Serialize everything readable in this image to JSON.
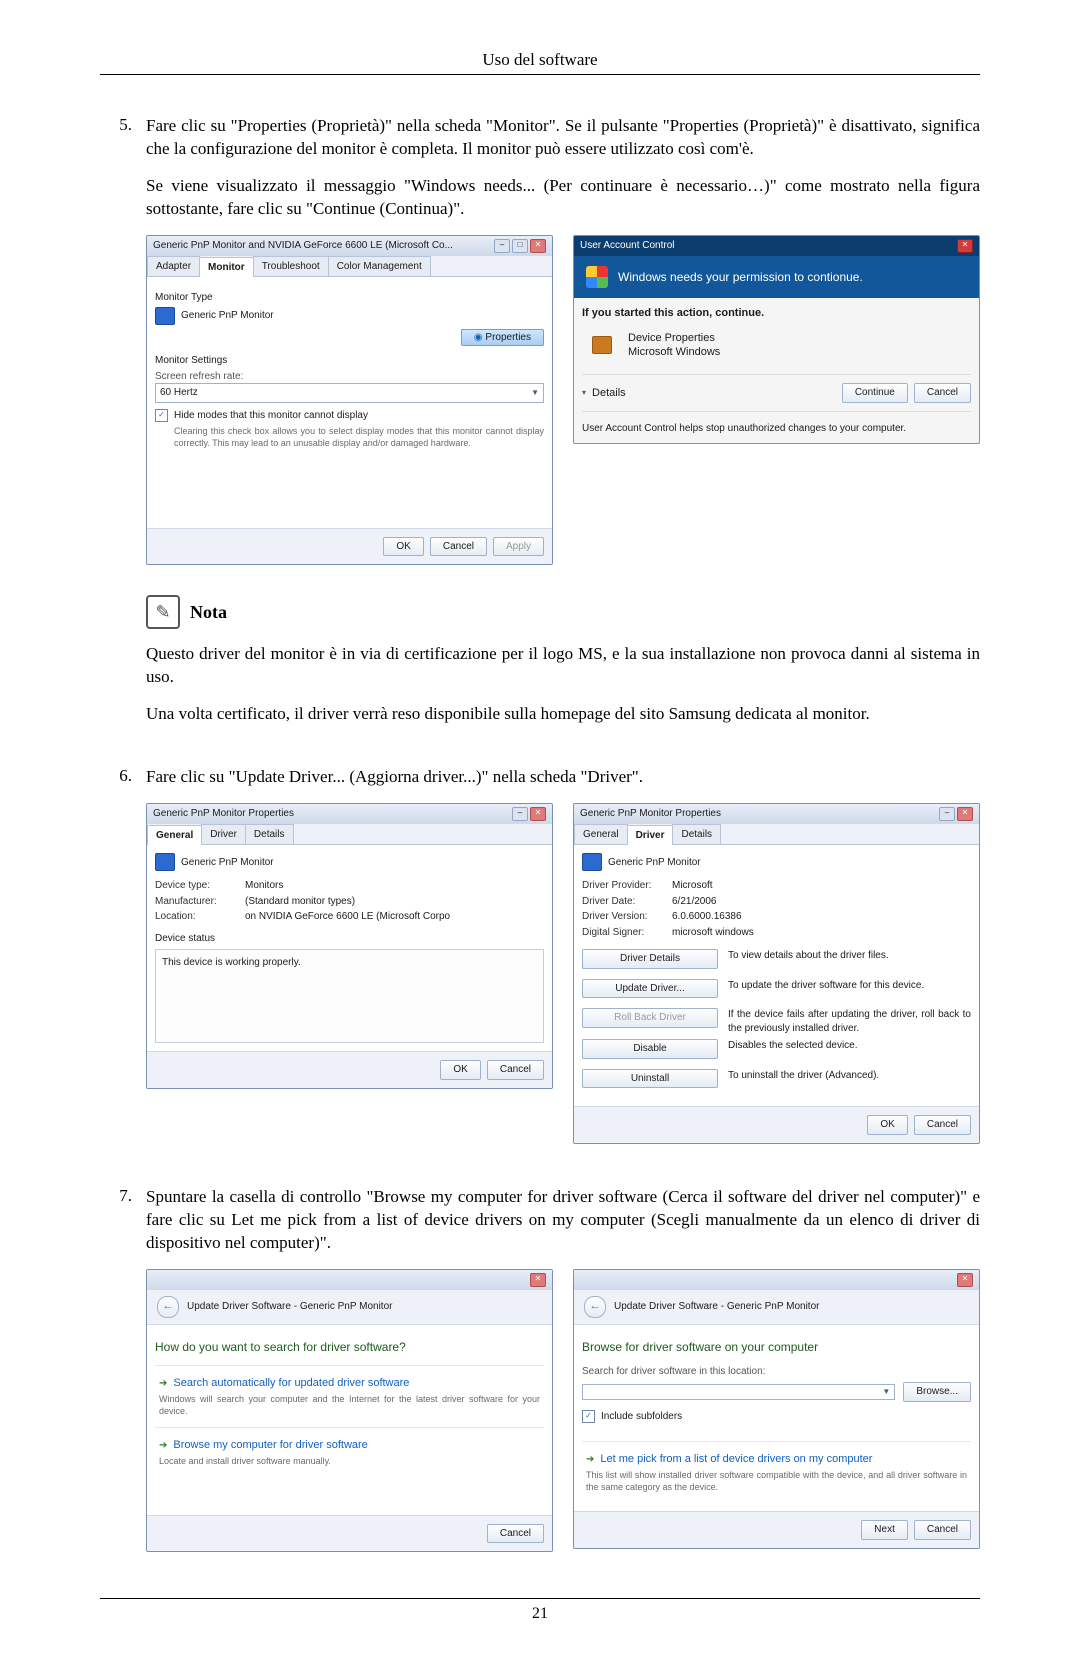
{
  "header": {
    "running_head": "Uso del software"
  },
  "footer": {
    "page_number": "21"
  },
  "steps": {
    "s5": {
      "num": "5.",
      "p1": "Fare clic su \"Properties (Proprietà)\" nella scheda \"Monitor\". Se il pulsante \"Properties (Proprietà)\" è disattivato, significa che la configurazione del monitor è completa. Il monitor può essere utilizzato così com'è.",
      "p2": "Se viene visualizzato il messaggio \"Windows needs... (Per continuare è necessario…)\" come mostrato nella figura sottostante, fare clic su \"Continue (Continua)\"."
    },
    "s6": {
      "num": "6.",
      "p1": "Fare clic su \"Update Driver... (Aggiorna driver...)\" nella scheda \"Driver\"."
    },
    "s7": {
      "num": "7.",
      "p1": "Spuntare la casella di controllo \"Browse my computer for driver software (Cerca il software del driver nel computer)\" e fare clic su Let me pick from a list of device drivers on my computer (Scegli manualmente da un elenco di driver di dispositivo nel computer)\"."
    }
  },
  "note": {
    "label": "Nota",
    "p1": "Questo driver del monitor è in via di certificazione per il logo MS, e la sua installazione non provoca danni al sistema in uso.",
    "p2": "Una volta certificato, il driver verrà reso disponibile sulla homepage del sito Samsung dedicata al monitor."
  },
  "fig_monitor_props": {
    "title": "Generic PnP Monitor and NVIDIA GeForce 6600 LE (Microsoft Co...",
    "tabs": {
      "adapter": "Adapter",
      "monitor": "Monitor",
      "troubleshoot": "Troubleshoot",
      "color": "Color Management"
    },
    "monitor_type_label": "Monitor Type",
    "monitor_type_value": "Generic PnP Monitor",
    "properties_btn": "Properties",
    "settings_label": "Monitor Settings",
    "refresh_label": "Screen refresh rate:",
    "refresh_value": "60 Hertz",
    "hide_modes_label": "Hide modes that this monitor cannot display",
    "hide_modes_desc": "Clearing this check box allows you to select display modes that this monitor cannot display correctly. This may lead to an unusable display and/or damaged hardware.",
    "ok": "OK",
    "cancel": "Cancel",
    "apply": "Apply"
  },
  "fig_uac": {
    "title": "User Account Control",
    "headline": "Windows needs your permission to contionue.",
    "if_started": "If you started this action, continue.",
    "prog_name": "Device Properties",
    "prog_pub": "Microsoft Windows",
    "details": "Details",
    "continue": "Continue",
    "cancel": "Cancel",
    "footer": "User Account Control helps stop unauthorized changes to your computer."
  },
  "fig_general": {
    "title": "Generic PnP Monitor Properties",
    "tabs": {
      "general": "General",
      "driver": "Driver",
      "details": "Details"
    },
    "name": "Generic PnP Monitor",
    "kv": {
      "type_k": "Device type:",
      "type_v": "Monitors",
      "manu_k": "Manufacturer:",
      "manu_v": "(Standard monitor types)",
      "loc_k": "Location:",
      "loc_v": "on NVIDIA GeForce 6600 LE (Microsoft Corpo"
    },
    "status_label": "Device status",
    "status_text": "This device is working properly.",
    "ok": "OK",
    "cancel": "Cancel"
  },
  "fig_driver": {
    "title": "Generic PnP Monitor Properties",
    "tabs": {
      "general": "General",
      "driver": "Driver",
      "details": "Details"
    },
    "name": "Generic PnP Monitor",
    "kv": {
      "prov_k": "Driver Provider:",
      "prov_v": "Microsoft",
      "date_k": "Driver Date:",
      "date_v": "6/21/2006",
      "ver_k": "Driver Version:",
      "ver_v": "6.0.6000.16386",
      "sign_k": "Digital Signer:",
      "sign_v": "microsoft windows"
    },
    "btns": {
      "details": "Driver Details",
      "details_d": "To view details about the driver files.",
      "update": "Update Driver...",
      "update_d": "To update the driver software for this device.",
      "rollback": "Roll Back Driver",
      "rollback_d": "If the device fails after updating the driver, roll back to the previously installed driver.",
      "disable": "Disable",
      "disable_d": "Disables the selected device.",
      "uninstall": "Uninstall",
      "uninstall_d": "To uninstall the driver (Advanced)."
    },
    "ok": "OK",
    "cancel": "Cancel"
  },
  "fig_wiz1": {
    "crumb": "Update Driver Software - Generic PnP Monitor",
    "heading": "How do you want to search for driver software?",
    "opt1_t": "Search automatically for updated driver software",
    "opt1_d": "Windows will search your computer and the Internet for the latest driver software for your device.",
    "opt2_t": "Browse my computer for driver software",
    "opt2_d": "Locate and install driver software manually.",
    "cancel": "Cancel"
  },
  "fig_wiz2": {
    "crumb": "Update Driver Software - Generic PnP Monitor",
    "heading": "Browse for driver software on your computer",
    "search_label": "Search for driver software in this location:",
    "path_value": "",
    "browse": "Browse...",
    "include_sub": "Include subfolders",
    "opt_t": "Let me pick from a list of device drivers on my computer",
    "opt_d": "This list will show installed driver software compatible with the device, and all driver software in the same category as the device.",
    "next": "Next",
    "cancel": "Cancel"
  },
  "win_btn": {
    "min": "‒",
    "max": "□",
    "close": "✕"
  }
}
